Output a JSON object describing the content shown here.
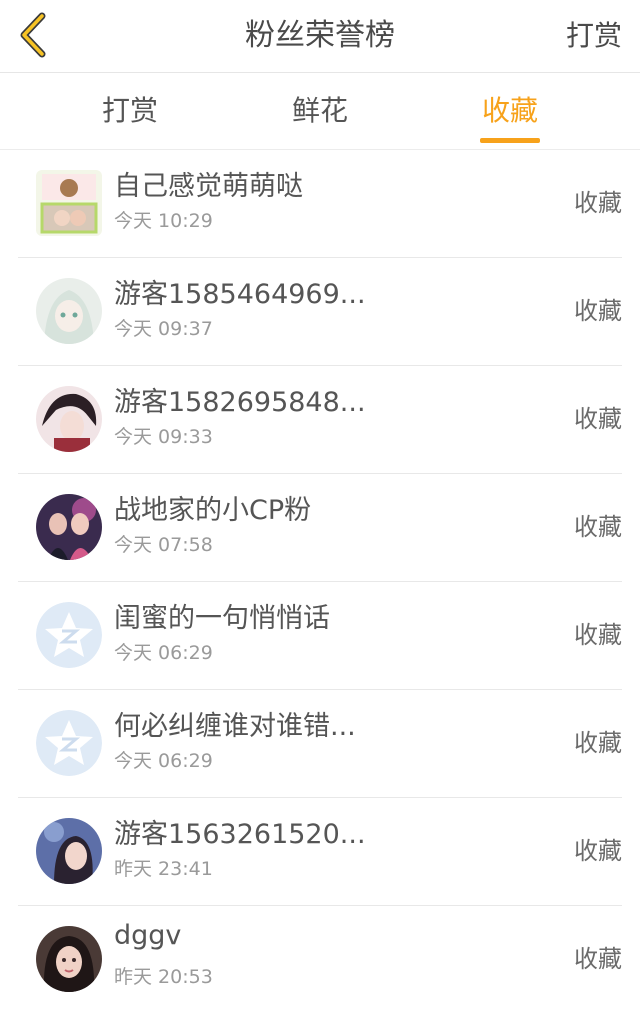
{
  "header": {
    "back_icon": "chevron-left-icon",
    "title": "粉丝荣誉榜",
    "action_label": "打赏"
  },
  "tabs": [
    {
      "label": "打赏",
      "active": false
    },
    {
      "label": "鲜花",
      "active": false
    },
    {
      "label": "收藏",
      "active": true
    }
  ],
  "accent_color": "#f7a21b",
  "list": [
    {
      "name": "自己感觉萌萌哒",
      "time": "今天 10:29",
      "badge": "收藏",
      "avatar": "photo-collage"
    },
    {
      "name": "游客1585464969...",
      "time": "今天 09:37",
      "badge": "收藏",
      "avatar": "anime-girl"
    },
    {
      "name": "游客1582695848...",
      "time": "今天 09:33",
      "badge": "收藏",
      "avatar": "anime-boy"
    },
    {
      "name": "战地家的小CP粉",
      "time": "今天 07:58",
      "badge": "收藏",
      "avatar": "couple-photo"
    },
    {
      "name": "闺蜜的一句悄悄话",
      "time": "今天 06:29",
      "badge": "收藏",
      "avatar": "default-qq-star"
    },
    {
      "name": "何必纠缠谁对谁错...",
      "time": "今天 06:29",
      "badge": "收藏",
      "avatar": "default-qq-star"
    },
    {
      "name": "游客1563261520...",
      "time": "昨天 23:41",
      "badge": "收藏",
      "avatar": "girl-portrait"
    },
    {
      "name": "dggv",
      "time": "昨天 20:53",
      "badge": "收藏",
      "avatar": "girl-selfie"
    }
  ]
}
